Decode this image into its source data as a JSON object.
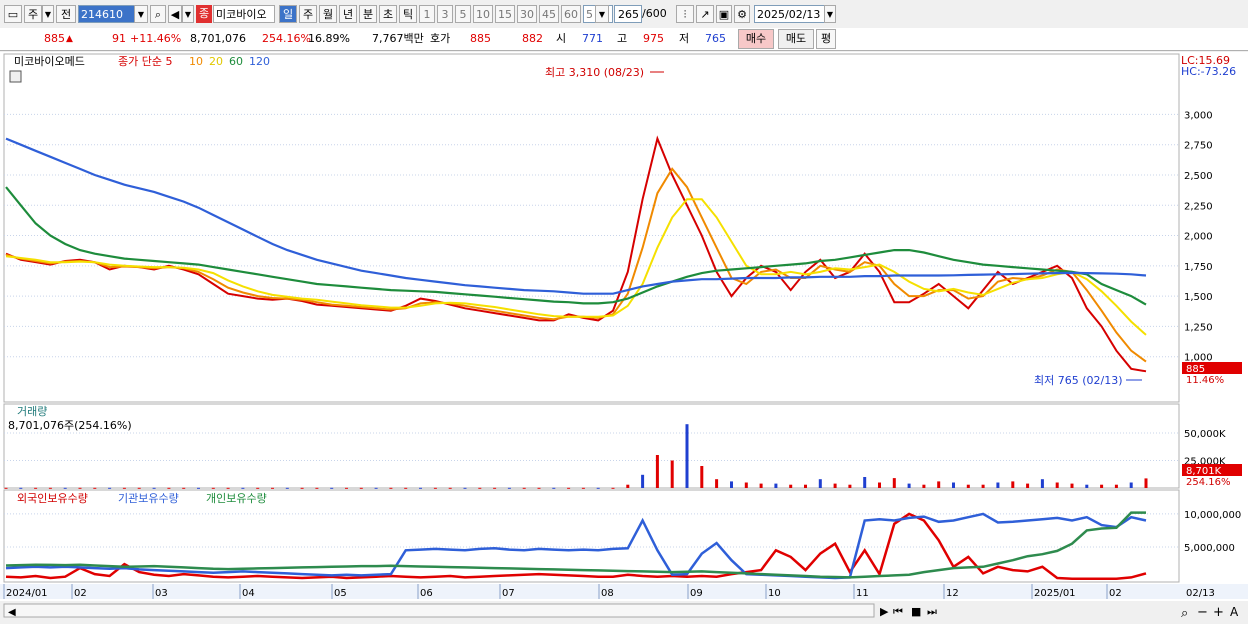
{
  "toolbar": {
    "market": "주",
    "prev_label": "전",
    "code": "214610",
    "stock_name": "미코바이오",
    "stock_badge": "종",
    "periods": [
      "일",
      "주",
      "월",
      "년",
      "분",
      "초",
      "틱"
    ],
    "active_period": "일",
    "intervals": [
      "1",
      "3",
      "5",
      "10",
      "15",
      "30",
      "45",
      "60"
    ],
    "interval_value": "5",
    "count": "265",
    "count_max": "/600",
    "date": "2025/02/13"
  },
  "quote": {
    "price": "885",
    "change": "91",
    "change_pct": "+11.46%",
    "volume": "8,701,076",
    "volume_ratio": "254.16%",
    "turnover": "16.89%",
    "amount": "7,767백만",
    "hoga_label": "호가",
    "ask": "885",
    "bid": "882",
    "open_label": "시",
    "open": "771",
    "high_label": "고",
    "high": "975",
    "low_label": "저",
    "low": "765",
    "buy_label": "매수",
    "sell_label": "매도",
    "eval_label": "평"
  },
  "colors": {
    "up": "#e00000",
    "down": "#1f3fd0",
    "ma5": "#d60000",
    "ma10": "#f08a00",
    "ma20": "#f5e000",
    "ma60": "#1e8c3c",
    "ma120": "#2f5fd8"
  },
  "chart_data": [
    {
      "type": "line",
      "title": "미코바이오메드",
      "legend": [
        "종가 단순 5",
        "10",
        "20",
        "60",
        "120"
      ],
      "x_labels": [
        "2024/01",
        "02",
        "03",
        "04",
        "05",
        "06",
        "07",
        "08",
        "09",
        "10",
        "11",
        "12",
        "2025/01",
        "02",
        "02/13"
      ],
      "y_ticks": [
        1000,
        1250,
        1500,
        1750,
        2000,
        2250,
        2500,
        2750,
        3000
      ],
      "ylim": [
        750,
        3350
      ],
      "lc": "LC:15.69",
      "hc": "HC:-73.26",
      "annotation_high": "최고 3,310 (08/23)",
      "annotation_low": "최저 765 (02/13)",
      "last_price_label": "885",
      "last_change_label": "11.46%",
      "series": [
        {
          "name": "5",
          "values": [
            1850,
            1800,
            1780,
            1760,
            1790,
            1800,
            1780,
            1720,
            1750,
            1740,
            1720,
            1750,
            1720,
            1680,
            1600,
            1520,
            1500,
            1480,
            1470,
            1480,
            1460,
            1430,
            1420,
            1410,
            1400,
            1390,
            1380,
            1420,
            1480,
            1460,
            1430,
            1400,
            1380,
            1360,
            1340,
            1320,
            1300,
            1300,
            1350,
            1320,
            1300,
            1380,
            1700,
            2300,
            2800,
            2500,
            2250,
            2000,
            1700,
            1500,
            1650,
            1750,
            1700,
            1550,
            1700,
            1800,
            1650,
            1700,
            1850,
            1700,
            1450,
            1450,
            1520,
            1600,
            1500,
            1400,
            1550,
            1700,
            1600,
            1650,
            1700,
            1750,
            1650,
            1400,
            1250,
            1050,
            900,
            880
          ]
        },
        {
          "name": "10",
          "values": [
            1840,
            1810,
            1790,
            1770,
            1785,
            1790,
            1780,
            1740,
            1745,
            1740,
            1730,
            1740,
            1730,
            1700,
            1640,
            1570,
            1530,
            1500,
            1485,
            1480,
            1470,
            1450,
            1430,
            1420,
            1410,
            1400,
            1390,
            1400,
            1440,
            1450,
            1440,
            1420,
            1400,
            1380,
            1360,
            1340,
            1320,
            1310,
            1330,
            1330,
            1320,
            1350,
            1520,
            1900,
            2350,
            2550,
            2400,
            2150,
            1900,
            1650,
            1600,
            1700,
            1720,
            1650,
            1650,
            1750,
            1720,
            1700,
            1780,
            1750,
            1600,
            1500,
            1500,
            1550,
            1550,
            1480,
            1500,
            1620,
            1650,
            1640,
            1670,
            1720,
            1700,
            1550,
            1380,
            1200,
            1050,
            960
          ]
        },
        {
          "name": "20",
          "values": [
            1830,
            1815,
            1800,
            1780,
            1780,
            1785,
            1780,
            1760,
            1750,
            1745,
            1740,
            1740,
            1735,
            1720,
            1690,
            1630,
            1580,
            1540,
            1510,
            1495,
            1480,
            1470,
            1455,
            1440,
            1425,
            1415,
            1405,
            1405,
            1420,
            1440,
            1445,
            1440,
            1425,
            1410,
            1390,
            1370,
            1350,
            1335,
            1330,
            1330,
            1330,
            1340,
            1420,
            1600,
            1900,
            2150,
            2300,
            2300,
            2150,
            1950,
            1750,
            1680,
            1680,
            1700,
            1680,
            1700,
            1730,
            1720,
            1740,
            1760,
            1700,
            1620,
            1560,
            1540,
            1560,
            1530,
            1510,
            1560,
            1610,
            1640,
            1650,
            1680,
            1700,
            1640,
            1540,
            1420,
            1290,
            1180
          ]
        },
        {
          "name": "60",
          "values": [
            2400,
            2250,
            2100,
            2000,
            1930,
            1880,
            1850,
            1830,
            1810,
            1800,
            1790,
            1780,
            1770,
            1760,
            1740,
            1720,
            1700,
            1680,
            1660,
            1640,
            1620,
            1600,
            1590,
            1580,
            1570,
            1560,
            1550,
            1545,
            1540,
            1535,
            1525,
            1515,
            1505,
            1495,
            1485,
            1475,
            1465,
            1455,
            1450,
            1440,
            1440,
            1450,
            1480,
            1530,
            1580,
            1620,
            1660,
            1690,
            1710,
            1720,
            1730,
            1740,
            1750,
            1760,
            1770,
            1790,
            1800,
            1820,
            1840,
            1860,
            1880,
            1880,
            1860,
            1830,
            1800,
            1780,
            1760,
            1750,
            1740,
            1730,
            1720,
            1710,
            1700,
            1680,
            1600,
            1550,
            1500,
            1430
          ]
        },
        {
          "name": "120",
          "values": [
            2800,
            2750,
            2700,
            2650,
            2600,
            2550,
            2500,
            2460,
            2420,
            2390,
            2360,
            2320,
            2280,
            2230,
            2170,
            2110,
            2050,
            1990,
            1930,
            1880,
            1840,
            1800,
            1770,
            1740,
            1710,
            1690,
            1670,
            1650,
            1635,
            1620,
            1605,
            1590,
            1580,
            1570,
            1560,
            1550,
            1545,
            1540,
            1530,
            1520,
            1520,
            1520,
            1550,
            1580,
            1600,
            1620,
            1630,
            1640,
            1640,
            1645,
            1650,
            1650,
            1650,
            1655,
            1655,
            1660,
            1660,
            1660,
            1665,
            1665,
            1670,
            1670,
            1670,
            1670,
            1672,
            1675,
            1678,
            1680,
            1682,
            1685,
            1688,
            1690,
            1692,
            1690,
            1688,
            1685,
            1680,
            1670
          ]
        }
      ]
    },
    {
      "type": "bar",
      "title": "거래량",
      "subtitle": "8,701,076주(254.16%)",
      "y_ticks": [
        25000,
        50000
      ],
      "y_tick_labels": [
        "25,000K",
        "50,000K"
      ],
      "ylim": [
        0,
        60000
      ],
      "last_label": "8,701K",
      "last_pct": "254.16%",
      "values": [
        150,
        150,
        150,
        150,
        150,
        150,
        150,
        150,
        150,
        150,
        150,
        150,
        150,
        150,
        150,
        150,
        150,
        150,
        150,
        150,
        150,
        150,
        150,
        150,
        150,
        150,
        150,
        150,
        150,
        150,
        150,
        150,
        150,
        150,
        150,
        150,
        150,
        150,
        150,
        150,
        150,
        150,
        3000,
        12000,
        30000,
        25000,
        58000,
        20000,
        8000,
        6000,
        5000,
        4000,
        4000,
        3000,
        3000,
        8000,
        4000,
        3000,
        10000,
        5000,
        9000,
        4000,
        3000,
        6000,
        5000,
        3000,
        3000,
        5000,
        6000,
        4000,
        8000,
        5000,
        4000,
        3000,
        3000,
        3000,
        5000,
        8701
      ]
    },
    {
      "type": "line",
      "legend": [
        "외국인보유수량",
        "기관보유수량",
        "개인보유수량"
      ],
      "y_ticks": [
        5000000,
        10000000
      ],
      "y_tick_labels": [
        "5,000,000",
        "10,000,000"
      ],
      "ylim": [
        0,
        11500000
      ],
      "series": [
        {
          "name": "외국인보유수량",
          "values": [
            500000,
            400000,
            600000,
            300000,
            500000,
            1800000,
            900000,
            600000,
            2400000,
            1200000,
            800000,
            600000,
            900000,
            700000,
            500000,
            400000,
            500000,
            600000,
            500000,
            400000,
            300000,
            400000,
            500000,
            300000,
            400000,
            500000,
            600000,
            500000,
            400000,
            500000,
            600000,
            400000,
            500000,
            600000,
            700000,
            800000,
            900000,
            800000,
            700000,
            600000,
            500000,
            500000,
            800000,
            600000,
            500000,
            600000,
            500000,
            600000,
            500000,
            900000,
            1200000,
            1500000,
            4500000,
            3500000,
            1500000,
            4000000,
            5500000,
            1200000,
            4500000,
            900000,
            8500000,
            10000000,
            9000000,
            6000000,
            2000000,
            3500000,
            1000000,
            2000000,
            1500000,
            1300000,
            2000000,
            300000,
            200000,
            200000,
            200000,
            200000,
            400000,
            1000000
          ]
        },
        {
          "name": "기관보유수량",
          "values": [
            1800000,
            1900000,
            2000000,
            1900000,
            2000000,
            1900000,
            1800000,
            1700000,
            1800000,
            1600000,
            1500000,
            1400000,
            1300000,
            1200000,
            1100000,
            1200000,
            1300000,
            1200000,
            1100000,
            1000000,
            900000,
            800000,
            700000,
            800000,
            700000,
            800000,
            900000,
            4500000,
            4600000,
            4700000,
            4600000,
            4500000,
            4700000,
            4800000,
            4600000,
            4500000,
            4700000,
            4600000,
            4500000,
            4600000,
            4500000,
            4700000,
            4800000,
            9000000,
            4500000,
            800000,
            900000,
            4000000,
            5600000,
            3000000,
            900000,
            800000,
            700000,
            600000,
            500000,
            400000,
            300000,
            400000,
            9000000,
            9200000,
            9000000,
            9400000,
            9600000,
            8800000,
            9000000,
            9500000,
            10000000,
            8700000,
            8800000,
            9000000,
            9200000,
            9400000,
            9000000,
            9500000,
            8300000,
            8000000,
            9500000,
            9000000
          ]
        },
        {
          "name": "개인보유수량",
          "values": [
            2200000,
            2250000,
            2300000,
            2280000,
            2260000,
            2300000,
            2200000,
            2100000,
            2000000,
            2050000,
            2100000,
            2000000,
            1900000,
            1800000,
            1700000,
            1650000,
            1700000,
            1750000,
            1800000,
            1850000,
            1900000,
            1950000,
            2000000,
            2050000,
            2100000,
            2100000,
            2150000,
            2100000,
            2050000,
            2000000,
            1950000,
            1900000,
            1850000,
            1800000,
            1750000,
            1700000,
            1650000,
            1600000,
            1550000,
            1500000,
            1450000,
            1400000,
            1350000,
            1300000,
            1250000,
            1200000,
            1250000,
            1300000,
            1200000,
            1100000,
            1000000,
            900000,
            800000,
            700000,
            600000,
            500000,
            450000,
            400000,
            500000,
            600000,
            700000,
            800000,
            1200000,
            1500000,
            1800000,
            1900000,
            2000000,
            2500000,
            3000000,
            3600000,
            3900000,
            4400000,
            5500000,
            7500000,
            7800000,
            7900000,
            10200000,
            10200000
          ]
        }
      ]
    }
  ],
  "nav": {
    "scroll_label": "◀",
    "play": "▶",
    "first": "⏮",
    "stop": "■",
    "last": "⏭",
    "zoom_out": "−",
    "zoom_in": "+",
    "text_tool": "A"
  }
}
